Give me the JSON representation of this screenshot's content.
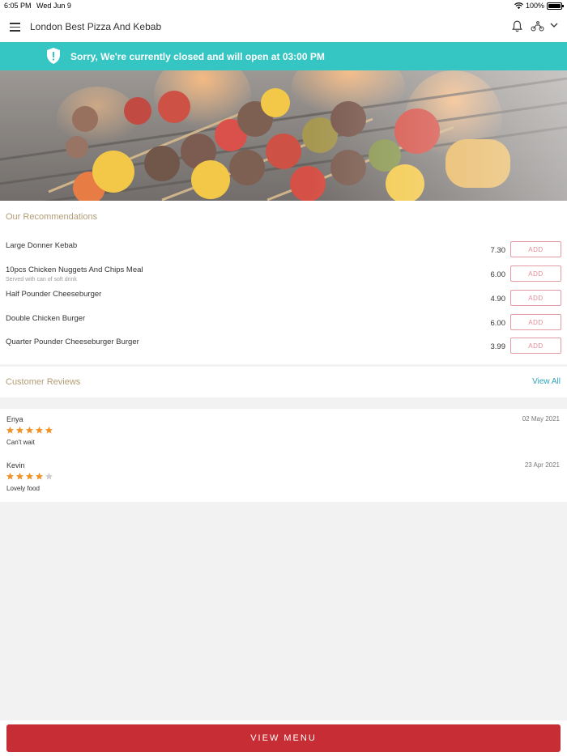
{
  "status_bar": {
    "time": "6:05 PM",
    "date": "Wed Jun 9",
    "battery": "100%"
  },
  "header": {
    "title": "London Best Pizza And Kebab",
    "icons": [
      "menu-icon",
      "bell-icon",
      "delivery-rider-icon",
      "chevron-down-icon"
    ]
  },
  "banner": {
    "message": "Sorry, We're currently closed and will open at 03:00 PM",
    "icon": "shield-alert-icon",
    "color": "#35c6c3"
  },
  "recommendations": {
    "title": "Our Recommendations",
    "items": [
      {
        "name": "Large Donner Kebab",
        "description": "",
        "price": "7.30",
        "button": "ADD"
      },
      {
        "name": "10pcs Chicken Nuggets And Chips Meal",
        "description": "Served with can of soft drink",
        "price": "6.00",
        "button": "ADD"
      },
      {
        "name": "Half Pounder Cheeseburger",
        "description": "",
        "price": "4.90",
        "button": "ADD"
      },
      {
        "name": "Double Chicken Burger",
        "description": "",
        "price": "6.00",
        "button": "ADD"
      },
      {
        "name": "Quarter Pounder Cheeseburger Burger",
        "description": "",
        "price": "3.99",
        "button": "ADD"
      }
    ]
  },
  "reviews": {
    "title": "Customer Reviews",
    "view_all": "View All",
    "items": [
      {
        "author": "Enya",
        "date": "02 May 2021",
        "rating": 5,
        "comment": "Can't wait"
      },
      {
        "author": "Kevin",
        "date": "23 Apr 2021",
        "rating": 4,
        "comment": "Lovely food"
      }
    ]
  },
  "footer": {
    "button": "VIEW MENU",
    "color": "#c62d34"
  }
}
